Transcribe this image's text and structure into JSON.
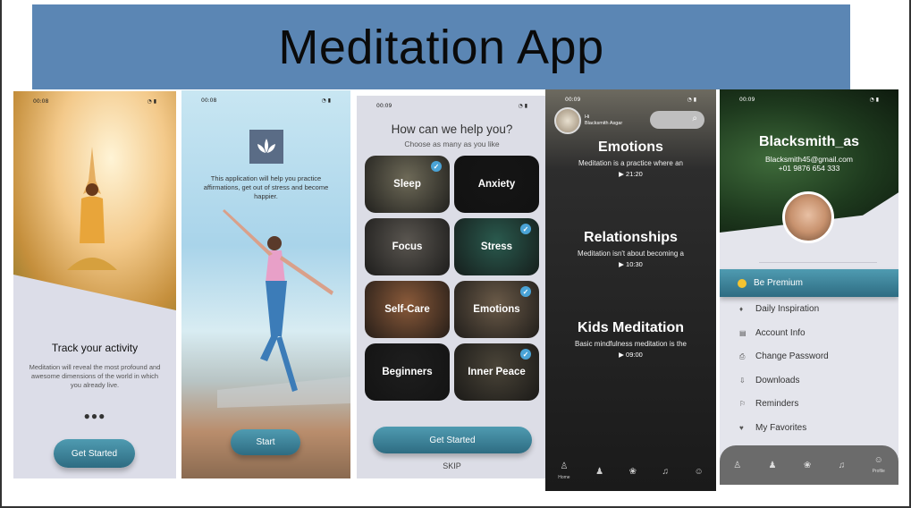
{
  "banner": {
    "title": "Meditation App"
  },
  "status": {
    "time1": "00:08",
    "time2": "00:08",
    "time3": "00:09",
    "time4": "00:09",
    "time5": "00:09"
  },
  "screen1": {
    "heading": "Track your activity",
    "body": "Meditation will reveal the most profound and awesome dimensions of the world in which you already live.",
    "dots": "●●●",
    "button": "Get Started"
  },
  "screen2": {
    "body": "This application will help you practice affirmations, get out of stress and become happier.",
    "button": "Start"
  },
  "screen3": {
    "title": "How can we help you?",
    "subtitle": "Choose as many as you like",
    "tiles": [
      {
        "label": "Sleep",
        "checked": true,
        "color": "#6e6a58"
      },
      {
        "label": "Anxiety",
        "checked": false,
        "color": "#151515"
      },
      {
        "label": "Focus",
        "checked": false,
        "color": "#5a5650"
      },
      {
        "label": "Stress",
        "checked": true,
        "color": "#2a5a4e"
      },
      {
        "label": "Self-Care",
        "checked": false,
        "color": "#8a5a3a"
      },
      {
        "label": "Emotions",
        "checked": true,
        "color": "#6a5a48"
      },
      {
        "label": "Beginners",
        "checked": false,
        "color": "#1e1e1e"
      },
      {
        "label": "Inner Peace",
        "checked": true,
        "color": "#4a4438"
      }
    ],
    "button": "Get Started",
    "skip": "SKIP"
  },
  "screen4": {
    "greeting": "Hi",
    "user": "Blacksmith Asgar",
    "sections": [
      {
        "title": "Emotions",
        "desc": "Meditation is a practice where an",
        "time": "21:20"
      },
      {
        "title": "Relationships",
        "desc": "Meditation isn't about becoming a",
        "time": "10:30"
      },
      {
        "title": "Kids Meditation",
        "desc": "Basic mindfulness meditation is the",
        "time": "09:00"
      }
    ],
    "nav": {
      "home": "Home"
    }
  },
  "screen5": {
    "name": "Blacksmith_as",
    "email": "Blacksmith45@gmail.com",
    "phone": "+01 9876 654 333",
    "premium": "Be Premium",
    "menu": [
      "Daily Inspiration",
      "Account Info",
      "Change Password",
      "Downloads",
      "Reminders",
      "My Favorites"
    ],
    "nav": {
      "profile": "Profile"
    }
  }
}
